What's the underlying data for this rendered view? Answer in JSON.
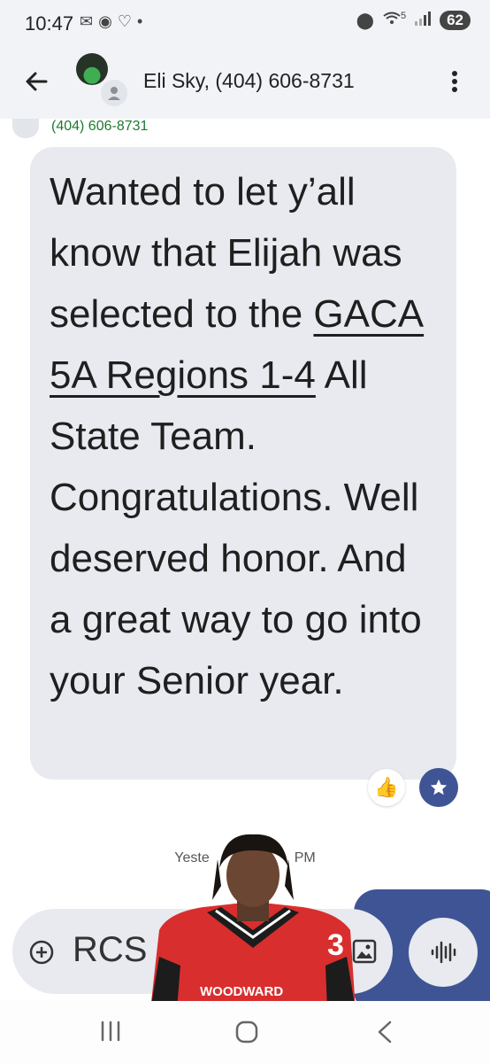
{
  "status_bar": {
    "time": "10:47",
    "notification_icons": [
      "mail-icon",
      "basketball-icon",
      "heart-pulse-icon",
      "dot-icon"
    ],
    "battery": "62",
    "wifi_label": "5"
  },
  "header": {
    "title": "Eli Sky, (404) 606-8731"
  },
  "conversation": {
    "sender_number": "(404) 606-8731",
    "message_parts": {
      "p1": "Wanted to let y’all know that Elijah was selected to the ",
      "link": "GACA 5A Regions 1-4",
      "p2": " All State Team. Congratulations. Well deserved honor. And a great way to go into your Senior year."
    },
    "reactions": [
      "thumbs-up",
      "star"
    ],
    "timestamp_visible_start": "Yeste",
    "timestamp_visible_end": "PM"
  },
  "compose": {
    "placeholder": "RCS"
  },
  "colors": {
    "accent": "#3f5495",
    "bubble": "#e8eaf0",
    "sender_green": "#1e7a2f"
  }
}
